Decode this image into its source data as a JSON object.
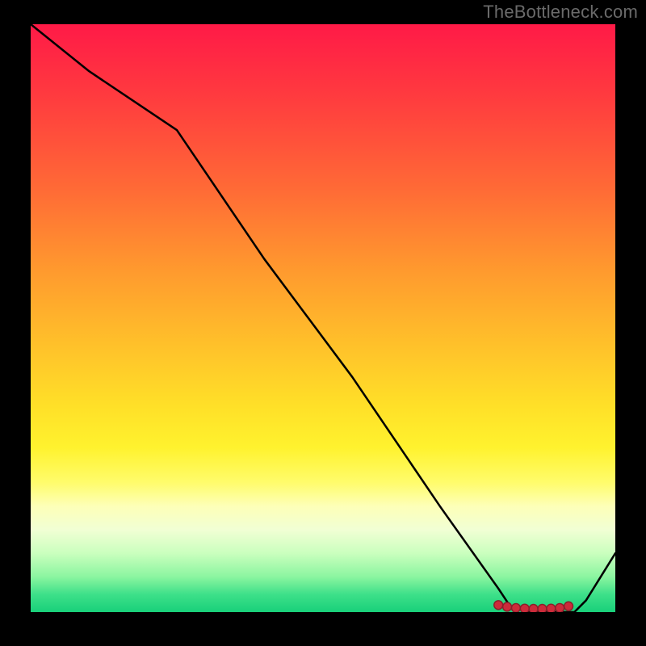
{
  "attribution": "TheBottleneck.com",
  "chart_data": {
    "type": "line",
    "title": "",
    "xlabel": "",
    "ylabel": "",
    "xlim": [
      0,
      100
    ],
    "ylim": [
      0,
      100
    ],
    "series": [
      {
        "name": "curve",
        "x": [
          0,
          10,
          25,
          40,
          55,
          70,
          80,
          82,
          85,
          88,
          90,
          93,
          95,
          100
        ],
        "values": [
          100,
          92,
          82,
          60,
          40,
          18,
          4,
          1,
          0,
          0,
          0,
          0,
          2,
          10
        ]
      }
    ],
    "markers": {
      "name": "highlight",
      "x": [
        80,
        81.5,
        83,
        84.5,
        86,
        87.5,
        89,
        90.5,
        92
      ],
      "values": [
        1.2,
        0.9,
        0.7,
        0.6,
        0.55,
        0.55,
        0.6,
        0.7,
        1.0
      ]
    },
    "gradient_stops": [
      {
        "pct": 0,
        "color": "#ff1a47"
      },
      {
        "pct": 12,
        "color": "#ff3a3f"
      },
      {
        "pct": 28,
        "color": "#ff6a36"
      },
      {
        "pct": 42,
        "color": "#ff9a2e"
      },
      {
        "pct": 55,
        "color": "#ffc22a"
      },
      {
        "pct": 65,
        "color": "#ffe028"
      },
      {
        "pct": 72,
        "color": "#fff22e"
      },
      {
        "pct": 78,
        "color": "#fffc6c"
      },
      {
        "pct": 82,
        "color": "#fdffb8"
      },
      {
        "pct": 86,
        "color": "#f1ffd4"
      },
      {
        "pct": 90,
        "color": "#caffbe"
      },
      {
        "pct": 94,
        "color": "#8bf5a0"
      },
      {
        "pct": 97,
        "color": "#3de089"
      },
      {
        "pct": 100,
        "color": "#19d07a"
      }
    ],
    "colors": {
      "line": "#000000",
      "marker_fill": "#cc2b3a",
      "marker_stroke": "#8a1f2a",
      "background_frame": "#000000"
    }
  }
}
